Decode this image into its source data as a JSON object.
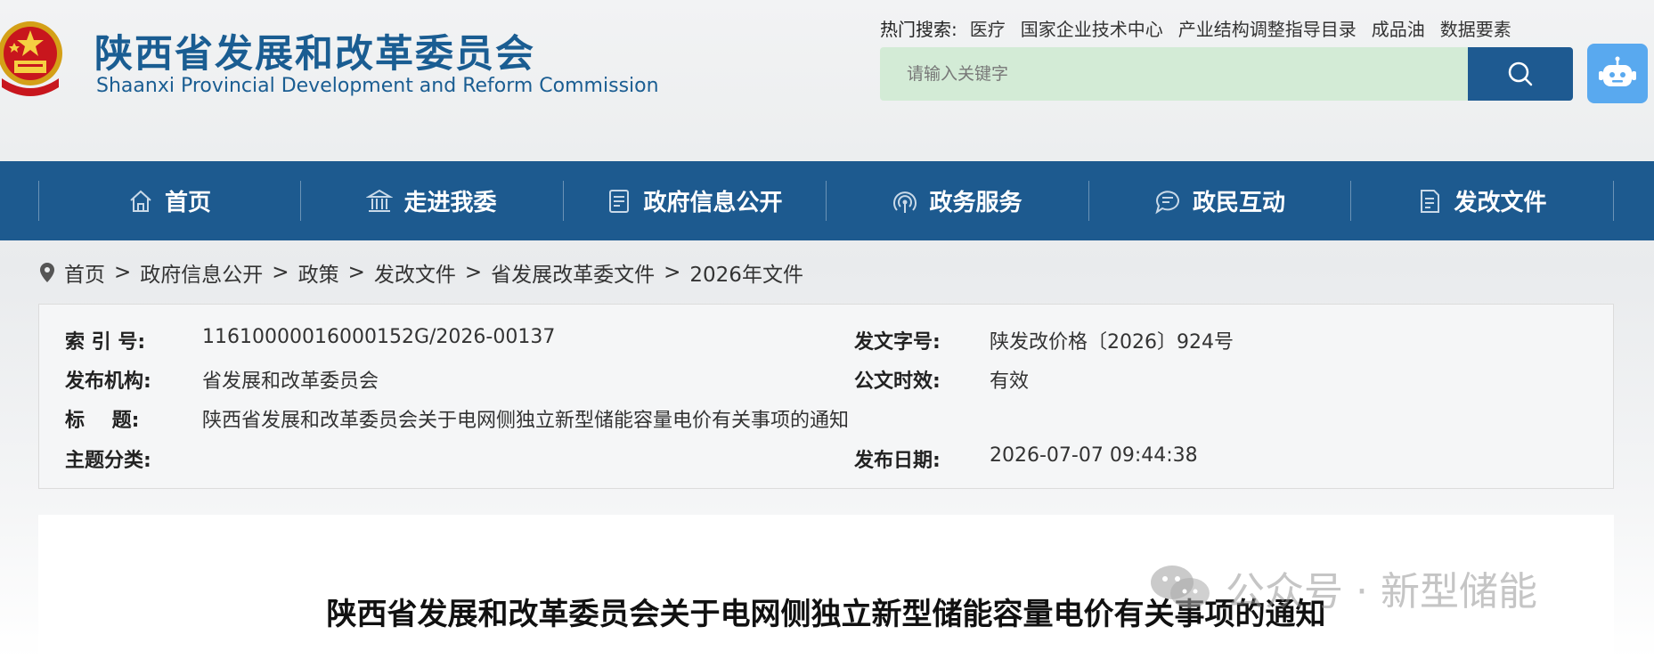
{
  "header": {
    "title_cn": "陕西省发展和改革委员会",
    "title_en": "Shaanxi Provincial Development and Reform Commission",
    "hot_search_label": "热门搜索:",
    "hot_search_items": [
      "医疗",
      "国家企业技术中心",
      "产业结构调整指导目录",
      "成品油",
      "数据要素"
    ],
    "search_placeholder": "请输入关键字"
  },
  "nav": {
    "items": [
      {
        "label": "首页",
        "icon": "home-icon"
      },
      {
        "label": "走进我委",
        "icon": "building-icon"
      },
      {
        "label": "政府信息公开",
        "icon": "document-icon"
      },
      {
        "label": "政务服务",
        "icon": "signal-icon"
      },
      {
        "label": "政民互动",
        "icon": "chat-icon"
      },
      {
        "label": "发改文件",
        "icon": "file-icon"
      }
    ]
  },
  "breadcrumb": {
    "items": [
      "首页",
      "政府信息公开",
      "政策",
      "发改文件",
      "省发展改革委文件",
      "2026年文件"
    ],
    "separator": ">"
  },
  "info": {
    "index_label": "索 引 号:",
    "index_value": "11610000016000152G/2026-00137",
    "doc_no_label": "发文字号:",
    "doc_no_value": "陕发改价格〔2026〕924号",
    "issuer_label": "发布机构:",
    "issuer_value": "省发展和改革委员会",
    "validity_label": "公文时效:",
    "validity_value": "有效",
    "title_label": "标    题:",
    "title_value": "陕西省发展和改革委员会关于电网侧独立新型储能容量电价有关事项的通知",
    "topic_label": "主题分类:",
    "topic_value": "",
    "date_label": "发布日期:",
    "date_value": "2026-07-07 09:44:38"
  },
  "content": {
    "doc_title": "陕西省发展和改革委员会关于电网侧独立新型储能容量电价有关事项的通知"
  },
  "watermark": {
    "text": "公众号 · 新型储能"
  },
  "colors": {
    "brand_blue": "#1d5a8f",
    "search_bg": "#d3ebd6",
    "robot_blue": "#59a9ef"
  }
}
